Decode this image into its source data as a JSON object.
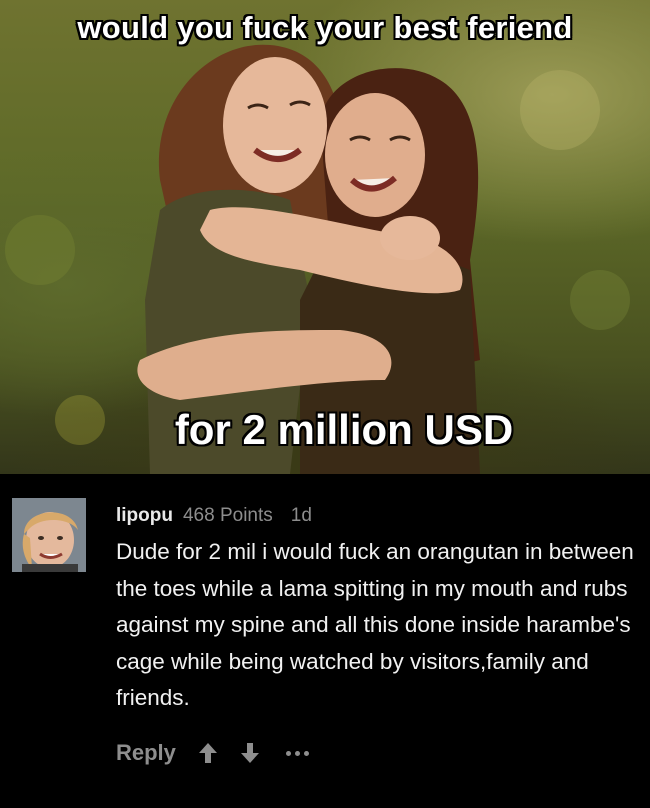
{
  "meme": {
    "caption_top": "would you fuck your best feriend",
    "caption_bottom": "for 2 million USD"
  },
  "comment": {
    "username": "lipopu",
    "points": "468 Points",
    "age": "1d",
    "body": "Dude for 2 mil i would fuck an orangutan in between the toes while a lama spitting in my mouth and rubs against my spine and all this done inside harambe's cage while being watched by visitors,family and friends.",
    "actions": {
      "reply_label": "Reply",
      "upvote_icon": "arrow-up-icon",
      "downvote_icon": "arrow-down-icon",
      "more_icon": "more-dots-icon"
    }
  },
  "colors": {
    "background": "#000000",
    "username": "#e9e9e9",
    "meta_gray": "#8d8d8d",
    "body_text": "#f1f1f1",
    "action_gray": "#8e8e8e"
  }
}
